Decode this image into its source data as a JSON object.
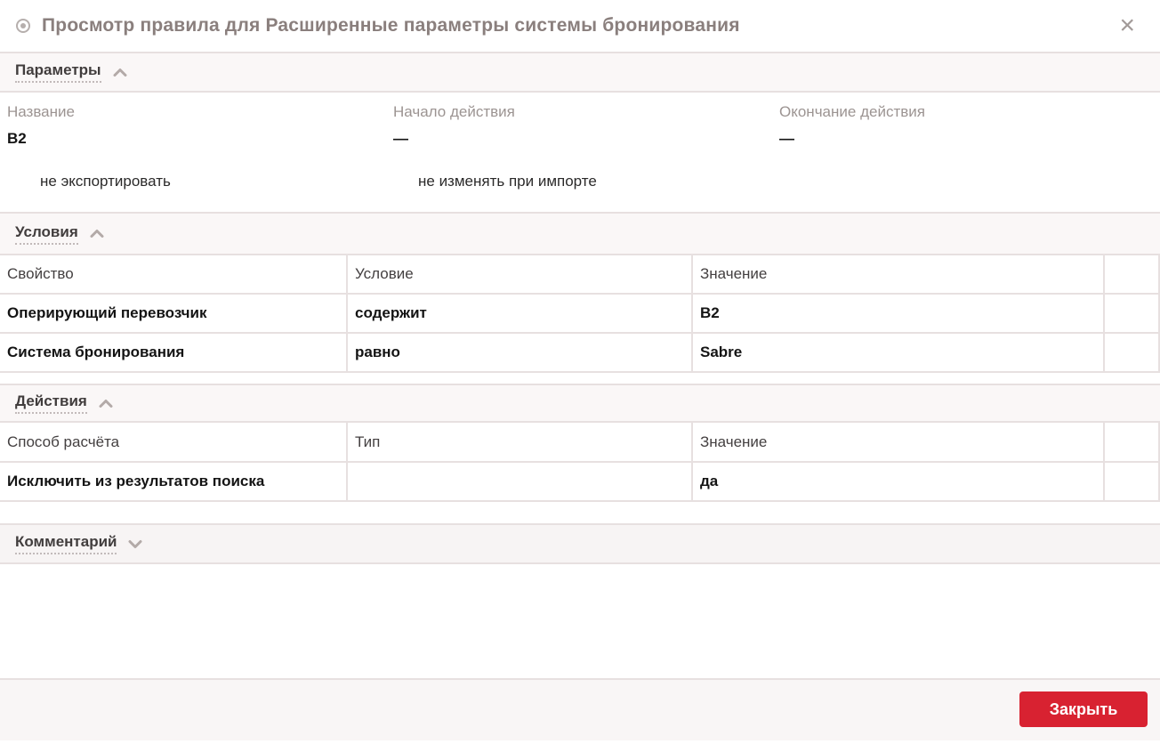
{
  "dialog": {
    "title": "Просмотр правила для Расширенные параметры системы бронирования"
  },
  "icons": {
    "close_glyph": "×"
  },
  "sections": {
    "parameters": {
      "title": "Параметры",
      "fields": [
        {
          "label": "Название",
          "value": "B2"
        },
        {
          "label": "Начало действия",
          "value": "—"
        },
        {
          "label": "Окончание действия",
          "value": "—"
        }
      ],
      "flags": [
        "не экспортировать",
        "не изменять при импорте"
      ]
    },
    "conditions": {
      "title": "Условия",
      "columns": [
        "Свойство",
        "Условие",
        "Значение"
      ],
      "rows": [
        [
          "Оперирующий перевозчик",
          "содержит",
          "B2"
        ],
        [
          "Система бронирования",
          "равно",
          "Sabre"
        ]
      ]
    },
    "actions": {
      "title": "Действия",
      "columns": [
        "Способ расчёта",
        "Тип",
        "Значение"
      ],
      "rows": [
        [
          "Исключить из результатов поиска",
          "",
          "да"
        ]
      ]
    },
    "comment": {
      "title": "Комментарий"
    }
  },
  "footer": {
    "close_button": "Закрыть"
  },
  "colors": {
    "accent_red": "#d82231",
    "border": "#e7e0e0",
    "title_text": "#8a7f7d",
    "band_bg": "#faf7f7"
  }
}
